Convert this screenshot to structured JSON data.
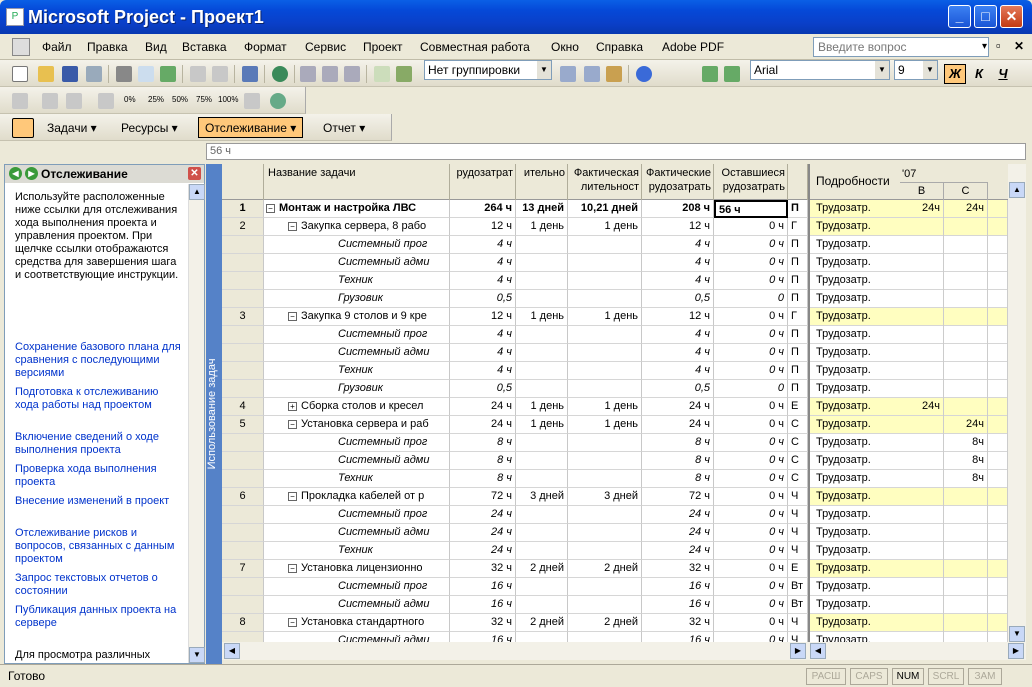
{
  "window": {
    "title": "Microsoft Project - Проект1",
    "app_glyph": "P",
    "min": "_",
    "max": "□",
    "close": "✕"
  },
  "menu": {
    "items": [
      "Файл",
      "Правка",
      "Вид",
      "Вставка",
      "Формат",
      "Сервис",
      "Проект",
      "Совместная работа",
      "Окно",
      "Справка",
      "Adobe PDF"
    ],
    "help_placeholder": "Введите вопрос",
    "doc_controls": [
      "▾",
      "▫",
      "✕"
    ]
  },
  "toolbar": {
    "grouping": "Нет группировки",
    "font": "Arial",
    "size": "9",
    "bold": "Ж",
    "italic": "К",
    "underline": "Ч",
    "zoom_labels": [
      "0%",
      "25%",
      "50%",
      "75%",
      "100%"
    ]
  },
  "guide": {
    "tasks": "Задачи",
    "resources": "Ресурсы",
    "tracking": "Отслеживание",
    "report": "Отчет",
    "dropdown": "▾"
  },
  "entry_bar": {
    "value": "56 ч"
  },
  "side_pane": {
    "title": "Отслеживание",
    "back": "◀",
    "forward": "▶",
    "close": "✕",
    "intro": "Используйте расположенные ниже ссылки для отслеживания хода выполнения проекта и управления проектом. При щелчке ссылки отображаются средства для завершения шага и соответствующие инструкции.",
    "links": [
      "Сохранение базового плана для сравнения с последующими версиями",
      "Подготовка к отслеживанию хода работы над проектом",
      "Включение сведений о ходе выполнения проекта",
      "Проверка хода выполнения проекта",
      "Внесение изменений в проект",
      "Отслеживание рисков и вопросов, связанных с данным проектом",
      "Запрос текстовых отчетов о состоянии",
      "Публикация данных проекта на сервере"
    ],
    "footer": "Для просмотра различных",
    "scroll_up": "▲",
    "scroll_down": "▼"
  },
  "view_label": "Использование задач",
  "grid": {
    "headers": {
      "name": "Название задачи",
      "work": "рудозатрат",
      "duration": "ительно",
      "actual_duration": "Фактическая\nлительност",
      "actual_work": "Фактические\nрудозатрать",
      "remaining": "Оставшиеся\nрудозатрать"
    },
    "rows": [
      {
        "id": "1",
        "name": "Монтаж и настройка ЛВС",
        "work": "264 ч",
        "dur": "13 дней",
        "adur": "10,21 дней",
        "awork": "208 ч",
        "rem": "56 ч",
        "x": "П",
        "type": "summary",
        "toggle": "−"
      },
      {
        "id": "2",
        "name": "Закупка сервера, 8 рабо",
        "work": "12 ч",
        "dur": "1 день",
        "adur": "1 день",
        "awork": "12 ч",
        "rem": "0 ч",
        "x": "Г",
        "type": "task",
        "toggle": "−"
      },
      {
        "id": "",
        "name": "Системный прог",
        "work": "4 ч",
        "dur": "",
        "adur": "",
        "awork": "4 ч",
        "rem": "0 ч",
        "x": "П",
        "type": "res"
      },
      {
        "id": "",
        "name": "Системный адми",
        "work": "4 ч",
        "dur": "",
        "adur": "",
        "awork": "4 ч",
        "rem": "0 ч",
        "x": "П",
        "type": "res"
      },
      {
        "id": "",
        "name": "Техник",
        "work": "4 ч",
        "dur": "",
        "adur": "",
        "awork": "4 ч",
        "rem": "0 ч",
        "x": "П",
        "type": "res"
      },
      {
        "id": "",
        "name": "Грузовик",
        "work": "0,5",
        "dur": "",
        "adur": "",
        "awork": "0,5",
        "rem": "0",
        "x": "П",
        "type": "res"
      },
      {
        "id": "3",
        "name": "Закупка 9 столов и 9 кре",
        "work": "12 ч",
        "dur": "1 день",
        "adur": "1 день",
        "awork": "12 ч",
        "rem": "0 ч",
        "x": "Г",
        "type": "task",
        "toggle": "−"
      },
      {
        "id": "",
        "name": "Системный прог",
        "work": "4 ч",
        "dur": "",
        "adur": "",
        "awork": "4 ч",
        "rem": "0 ч",
        "x": "П",
        "type": "res"
      },
      {
        "id": "",
        "name": "Системный адми",
        "work": "4 ч",
        "dur": "",
        "adur": "",
        "awork": "4 ч",
        "rem": "0 ч",
        "x": "П",
        "type": "res"
      },
      {
        "id": "",
        "name": "Техник",
        "work": "4 ч",
        "dur": "",
        "adur": "",
        "awork": "4 ч",
        "rem": "0 ч",
        "x": "П",
        "type": "res"
      },
      {
        "id": "",
        "name": "Грузовик",
        "work": "0,5",
        "dur": "",
        "adur": "",
        "awork": "0,5",
        "rem": "0",
        "x": "П",
        "type": "res"
      },
      {
        "id": "4",
        "name": "Сборка столов и кресел",
        "work": "24 ч",
        "dur": "1 день",
        "adur": "1 день",
        "awork": "24 ч",
        "rem": "0 ч",
        "x": "Е",
        "type": "task",
        "toggle": "+"
      },
      {
        "id": "5",
        "name": "Установка сервера и раб",
        "work": "24 ч",
        "dur": "1 день",
        "adur": "1 день",
        "awork": "24 ч",
        "rem": "0 ч",
        "x": "С",
        "type": "task",
        "toggle": "−"
      },
      {
        "id": "",
        "name": "Системный прог",
        "work": "8 ч",
        "dur": "",
        "adur": "",
        "awork": "8 ч",
        "rem": "0 ч",
        "x": "С",
        "type": "res"
      },
      {
        "id": "",
        "name": "Системный адми",
        "work": "8 ч",
        "dur": "",
        "adur": "",
        "awork": "8 ч",
        "rem": "0 ч",
        "x": "С",
        "type": "res"
      },
      {
        "id": "",
        "name": "Техник",
        "work": "8 ч",
        "dur": "",
        "adur": "",
        "awork": "8 ч",
        "rem": "0 ч",
        "x": "С",
        "type": "res"
      },
      {
        "id": "6",
        "name": "Прокладка кабелей от р",
        "work": "72 ч",
        "dur": "3 дней",
        "adur": "3 дней",
        "awork": "72 ч",
        "rem": "0 ч",
        "x": "Ч",
        "type": "task",
        "toggle": "−"
      },
      {
        "id": "",
        "name": "Системный прог",
        "work": "24 ч",
        "dur": "",
        "adur": "",
        "awork": "24 ч",
        "rem": "0 ч",
        "x": "Ч",
        "type": "res"
      },
      {
        "id": "",
        "name": "Системный адми",
        "work": "24 ч",
        "dur": "",
        "adur": "",
        "awork": "24 ч",
        "rem": "0 ч",
        "x": "Ч",
        "type": "res"
      },
      {
        "id": "",
        "name": "Техник",
        "work": "24 ч",
        "dur": "",
        "adur": "",
        "awork": "24 ч",
        "rem": "0 ч",
        "x": "Ч",
        "type": "res"
      },
      {
        "id": "7",
        "name": "Установка лицензионно",
        "work": "32 ч",
        "dur": "2 дней",
        "adur": "2 дней",
        "awork": "32 ч",
        "rem": "0 ч",
        "x": "Е",
        "type": "task",
        "toggle": "−"
      },
      {
        "id": "",
        "name": "Системный прог",
        "work": "16 ч",
        "dur": "",
        "adur": "",
        "awork": "16 ч",
        "rem": "0 ч",
        "x": "Вт",
        "type": "res"
      },
      {
        "id": "",
        "name": "Системный адми",
        "work": "16 ч",
        "dur": "",
        "adur": "",
        "awork": "16 ч",
        "rem": "0 ч",
        "x": "Вт",
        "type": "res"
      },
      {
        "id": "8",
        "name": "Установка стандартного",
        "work": "32 ч",
        "dur": "2 дней",
        "adur": "2 дней",
        "awork": "32 ч",
        "rem": "0 ч",
        "x": "Ч",
        "type": "task",
        "toggle": "−"
      },
      {
        "id": "",
        "name": "Системный адми",
        "work": "16 ч",
        "dur": "",
        "adur": "",
        "awork": "16 ч",
        "rem": "0 ч",
        "x": "Ч",
        "type": "res"
      }
    ]
  },
  "details": {
    "header": "Подробности",
    "label": "Трудозатр.",
    "timescale_top": "'07",
    "cols": [
      "В",
      "С"
    ],
    "values": [
      [
        "24ч",
        "24ч"
      ],
      [
        "",
        ""
      ],
      [
        "",
        ""
      ],
      [
        "",
        ""
      ],
      [
        "",
        ""
      ],
      [
        "",
        ""
      ],
      [
        "",
        ""
      ],
      [
        "",
        ""
      ],
      [
        "",
        ""
      ],
      [
        "",
        ""
      ],
      [
        "",
        ""
      ],
      [
        "24ч",
        ""
      ],
      [
        "",
        "24ч"
      ],
      [
        "",
        "8ч"
      ],
      [
        "",
        "8ч"
      ],
      [
        "",
        "8ч"
      ],
      [
        "",
        ""
      ],
      [
        "",
        ""
      ],
      [
        "",
        ""
      ],
      [
        "",
        ""
      ],
      [
        "",
        ""
      ],
      [
        "",
        ""
      ],
      [
        "",
        ""
      ],
      [
        "",
        ""
      ],
      [
        "",
        ""
      ]
    ]
  },
  "status": {
    "text": "Готово",
    "indicators": [
      "РАСШ",
      "CAPS",
      "NUM",
      "SCRL",
      "ЗАМ"
    ],
    "active": "NUM"
  }
}
